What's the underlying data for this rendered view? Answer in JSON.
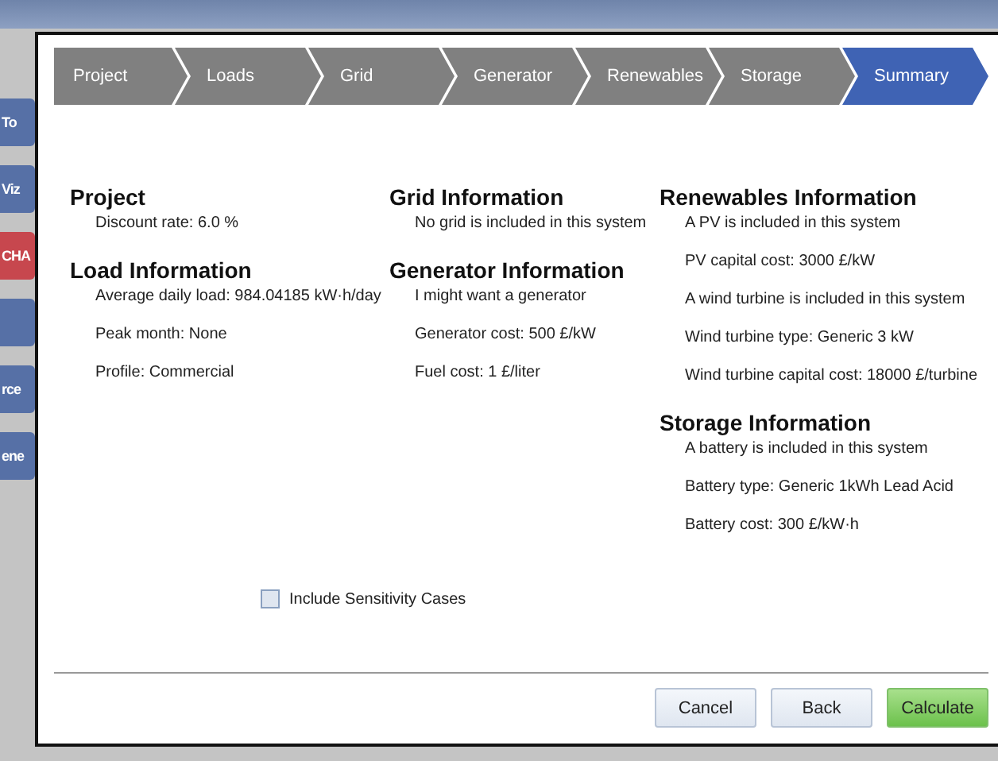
{
  "background": {
    "side_buttons": [
      {
        "label": "To",
        "kind": "plain"
      },
      {
        "label": "Viz",
        "kind": "plain"
      },
      {
        "label": "CHA",
        "kind": "alert"
      },
      {
        "kind": "plain"
      },
      {
        "label": "rce",
        "kind": "plain"
      },
      {
        "label": "ene",
        "kind": "plain"
      }
    ]
  },
  "steps": [
    {
      "label": "Project",
      "selected": false
    },
    {
      "label": "Loads",
      "selected": false
    },
    {
      "label": "Grid",
      "selected": false
    },
    {
      "label": "Generator",
      "selected": false
    },
    {
      "label": "Renewables",
      "selected": false
    },
    {
      "label": "Storage",
      "selected": false
    },
    {
      "label": "Summary",
      "selected": true
    }
  ],
  "columns": [
    [
      {
        "heading": "Project",
        "lines": [
          "Discount rate: 6.0 %"
        ]
      },
      {
        "heading": "Load Information",
        "lines": [
          "Average daily load: 984.04185 kW·h/day",
          "Peak month: None",
          "Profile: Commercial"
        ]
      }
    ],
    [
      {
        "heading": "Grid Information",
        "lines": [
          "No grid is included in this system"
        ]
      },
      {
        "heading": "Generator Information",
        "lines": [
          "I might want a generator",
          "Generator cost: 500 £/kW",
          "Fuel cost: 1 £/liter"
        ]
      }
    ],
    [
      {
        "heading": "Renewables Information",
        "lines": [
          "A PV is included in this system",
          "PV capital cost: 3000 £/kW",
          "A wind turbine is included in this system",
          "Wind turbine type: Generic 3 kW",
          "Wind turbine capital cost: 18000 £/turbine"
        ]
      },
      {
        "heading": "Storage Information",
        "lines": [
          "A battery is included in this system",
          "Battery type: Generic 1kWh Lead Acid",
          "Battery cost: 300 £/kW·h"
        ]
      }
    ]
  ],
  "sensitivity": {
    "label": "Include Sensitivity Cases",
    "checked": false
  },
  "buttons": [
    {
      "label": "Cancel",
      "kind": "normal"
    },
    {
      "label": "Back",
      "kind": "normal"
    },
    {
      "label": "Calculate",
      "kind": "primary"
    }
  ]
}
